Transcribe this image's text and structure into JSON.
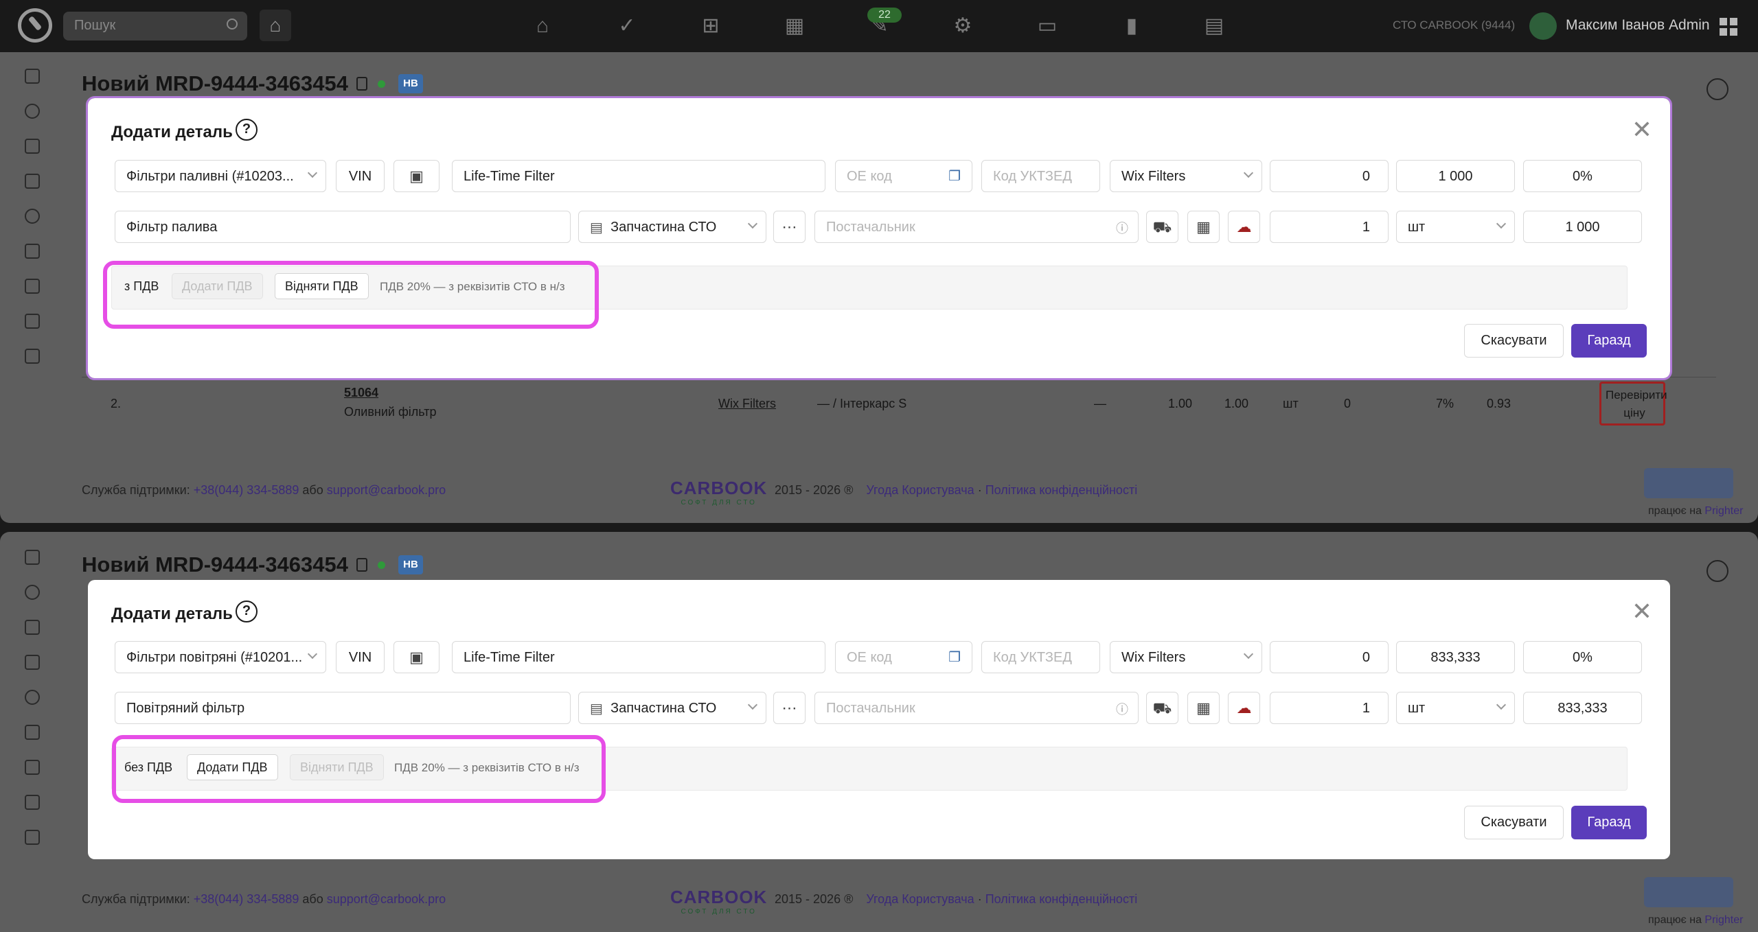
{
  "topbar": {
    "search_placeholder": "Пошук",
    "badge_count": "22",
    "org": "СТО CARBOOK (9444)",
    "user": "Максим Іванов Admin"
  },
  "page": {
    "title": "Новий MRD-9444-3463454",
    "status_badge": "НВ",
    "footer_support_label": "Служба підтримки:",
    "footer_phone": "+38(044) 334-5889",
    "footer_or": "або",
    "footer_email": "support@carbook.pro",
    "brand": "CARBOOK",
    "brand_tagline": "СОФТ ДЛЯ СТО",
    "years": "2015 - 2026 ®",
    "terms": "Угода Користувача",
    "privacy": "Політика конфіденційності",
    "works_on": "працює на",
    "righter": "Prighter"
  },
  "bg_row": {
    "num": "2.",
    "code": "51064",
    "name": "Оливний фільтр",
    "brand": "Wix Filters",
    "supplier": "— / Інтеркарс S",
    "dash": "—",
    "qty1": "1.00",
    "qty2": "1.00",
    "unit": "шт",
    "zero": "0",
    "pct": "7%",
    "price": "0.93",
    "check_price": "Перевірити ціну"
  },
  "modal_title": "Додати деталь",
  "modal1": {
    "group": "Фільтри паливні (#10203...",
    "vin": "VIN",
    "brand_name": "Life-Time Filter",
    "oe_placeholder": "ОЕ код",
    "uktzed_placeholder": "Код УКТЗЕД",
    "manufacturer": "Wix Filters",
    "v1": "0",
    "v2": "1 000",
    "v3": "0%",
    "name": "Фільтр палива",
    "type": "Запчастина СТО",
    "supplier_placeholder": "Постачальник",
    "qty": "1",
    "unit": "шт",
    "sum": "1 000",
    "vat_label": "з ПДВ",
    "add_vat": "Додати ПДВ",
    "sub_vat": "Відняти ПДВ",
    "vat_note": "ПДВ 20% — з реквізитів СТО в н/з",
    "cancel": "Скасувати",
    "ok": "Гаразд"
  },
  "modal2": {
    "group": "Фільтри повітряні (#10201...",
    "vin": "VIN",
    "brand_name": "Life-Time Filter",
    "oe_placeholder": "ОЕ код",
    "uktzed_placeholder": "Код УКТЗЕД",
    "manufacturer": "Wix Filters",
    "v1": "0",
    "v2": "833,333",
    "v3": "0%",
    "name": "Повітряний фільтр",
    "type": "Запчастина СТО",
    "supplier_placeholder": "Постачальник",
    "qty": "1",
    "unit": "шт",
    "sum": "833,333",
    "vat_label": "без ПДВ",
    "add_vat": "Додати ПДВ",
    "sub_vat": "Відняти ПДВ",
    "vat_note": "ПДВ 20% — з реквізитів СТО в н/з",
    "cancel": "Скасувати",
    "ok": "Гаразд"
  },
  "colors": {
    "accent": "#5b3dbb",
    "highlight": "#e64ee6",
    "status_dot": "#2f9a3a"
  }
}
